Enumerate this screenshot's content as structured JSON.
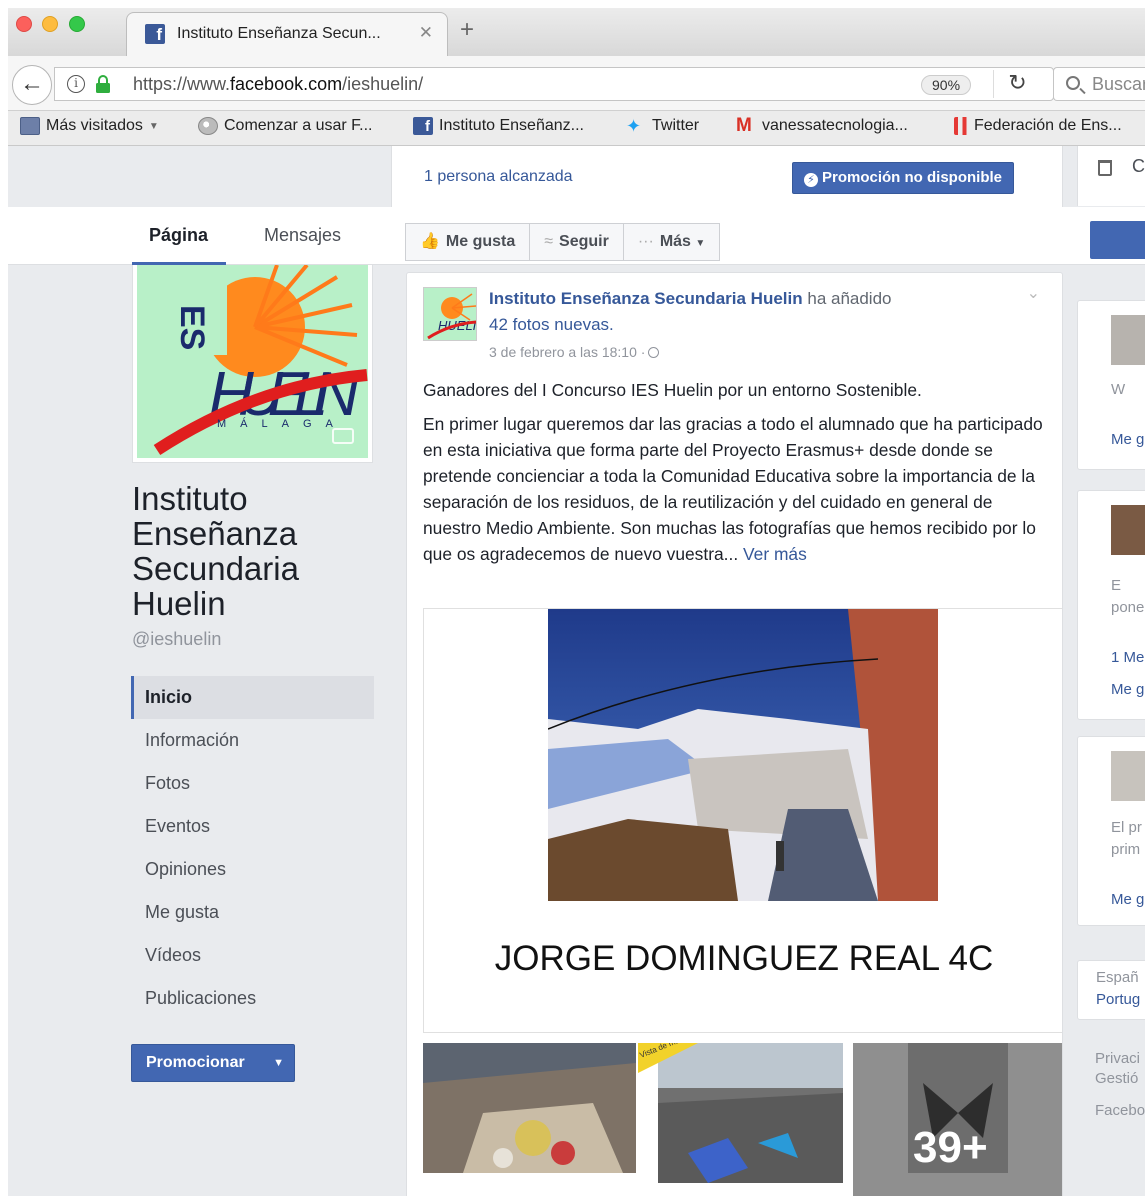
{
  "browser": {
    "tab_title": "Instituto Enseñanza Secun...",
    "tab_close": "✕",
    "new_tab": "+",
    "url_prefix": "https://www.",
    "url_domain": "facebook.com",
    "url_path": "/ieshuelin/",
    "zoom": "90%",
    "search_placeholder": "Buscar",
    "bookmarks": [
      {
        "label": "Más visitados",
        "icon": "folder-icon"
      },
      {
        "label": "Comenzar a usar F...",
        "icon": "globe-icon"
      },
      {
        "label": "Instituto Enseñanz...",
        "icon": "facebook-icon"
      },
      {
        "label": "Twitter",
        "icon": "twitter-icon"
      },
      {
        "label": "vanessatecnologia...",
        "icon": "gmail-icon"
      },
      {
        "label": "Federación de Ens...",
        "icon": "federation-icon"
      }
    ]
  },
  "page": {
    "reach_text": "1 persona alcanzada",
    "promo_button": "Promoción no disponible",
    "nav_tabs": [
      "Página",
      "Mensajes"
    ],
    "actions": [
      {
        "label": "Me gusta",
        "icon": "thumbs-up-icon"
      },
      {
        "label": "Seguir",
        "icon": "rss-icon"
      },
      {
        "label": "Más",
        "icon": "ellipsis-icon"
      }
    ],
    "page_name": "Instituto Enseñanza Secundaria Huelin",
    "handle": "@ieshuelin",
    "side_nav": [
      "Inicio",
      "Información",
      "Fotos",
      "Eventos",
      "Opiniones",
      "Me gusta",
      "Vídeos",
      "Publicaciones"
    ],
    "promote_button": "Promocionar",
    "right_partial_top": "C"
  },
  "post": {
    "author": "Instituto Enseñanza Secundaria Huelin",
    "action": "ha añadido",
    "photos_added": "42 fotos nuevas.",
    "date": "3 de febrero a las 18:10 ·",
    "paragraph1": "Ganadores del I Concurso IES Huelin por un entorno Sostenible.",
    "paragraph2": "En primer lugar queremos dar las gracias a todo el alumnado que ha participado en esta iniciativa que forma parte del Proyecto Erasmus+ desde donde se pretende concienciar a toda la Comunidad Educativa sobre la importancia de la separación de los residuos, de la reutilización y del cuidado en general de nuestro Medio Ambiente. Son muchas las fotografías que hemos recibido por lo que os agradecemos de nuevo vuestra...",
    "see_more": "Ver más",
    "photo_caption": "JORGE DOMINGUEZ REAL 4C",
    "more_photos": "39+",
    "thumb_badge": "Vista de más artística"
  },
  "right_column": {
    "items": [
      "W",
      "Me g",
      "E",
      "pone",
      "1 Me",
      "Me g",
      "El pr",
      "prim",
      "Me g",
      "Españ",
      "Portug",
      "Privaci",
      "Gestió",
      "Facebo"
    ]
  }
}
